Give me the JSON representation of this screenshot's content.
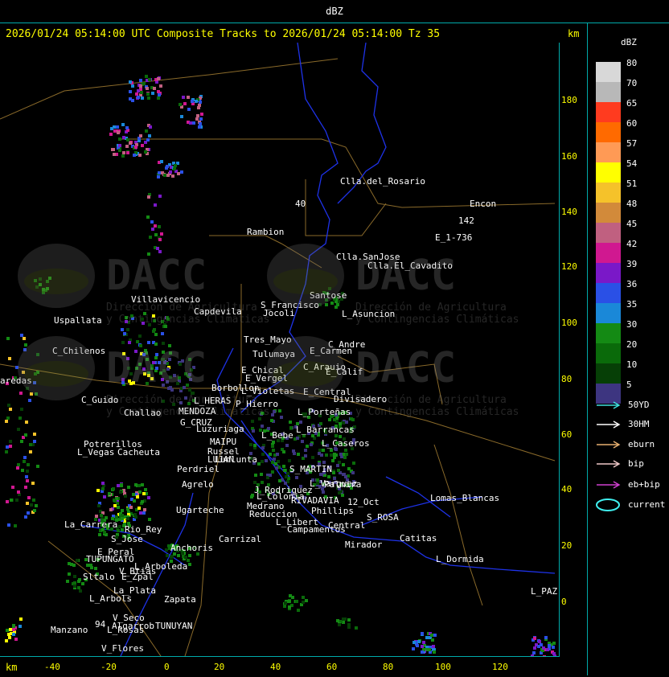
{
  "header": {
    "title": "dBZ"
  },
  "subtitle": "2026/01/24 05:14:00 UTC Composite Tracks to 2026/01/24 05:14:00 Tz 35",
  "axis": {
    "unit_top": "km",
    "unit_bottom": "km",
    "y_ticks": [
      "180",
      "160",
      "140",
      "120",
      "100",
      "80",
      "60",
      "40",
      "20",
      "0"
    ],
    "x_ticks": [
      "-40",
      "-20",
      "0",
      "20",
      "40",
      "60",
      "80",
      "100",
      "120"
    ]
  },
  "legend": {
    "title": "dBZ",
    "levels": [
      {
        "label": "80",
        "color": "#d8d8d8"
      },
      {
        "label": "70",
        "color": "#b8b8b8"
      },
      {
        "label": "65",
        "color": "#ff3b1f"
      },
      {
        "label": "60",
        "color": "#ff6a00"
      },
      {
        "label": "57",
        "color": "#ff9a55"
      },
      {
        "label": "54",
        "color": "#ffff00"
      },
      {
        "label": "51",
        "color": "#f5c22a"
      },
      {
        "label": "48",
        "color": "#d28a3a"
      },
      {
        "label": "45",
        "color": "#c06080"
      },
      {
        "label": "42",
        "color": "#d01890"
      },
      {
        "label": "39",
        "color": "#7a18c8"
      },
      {
        "label": "36",
        "color": "#2a50e6"
      },
      {
        "label": "35",
        "color": "#1a88d8"
      },
      {
        "label": "30",
        "color": "#148a14"
      },
      {
        "label": "20",
        "color": "#0a6a0a"
      },
      {
        "label": "10",
        "color": "#063f06"
      },
      {
        "label": "5",
        "color": "#3d3580"
      }
    ],
    "tracks": [
      {
        "label": "50YD",
        "color": "#40e0e0"
      },
      {
        "label": "30HM",
        "color": "#ffffff"
      },
      {
        "label": "eburn",
        "color": "#e8b070"
      },
      {
        "label": "bip",
        "color": "#f0c8c8"
      },
      {
        "label": "eb+bip",
        "color": "#d040d0"
      },
      {
        "label": "current",
        "color": "#40f0f0"
      }
    ]
  },
  "watermark": {
    "brand": "DACC",
    "line1": "Dirección de Agricultura",
    "line2": "y Contingencias Climáticas"
  },
  "places": [
    "Clla.del_Rosario",
    "Encon",
    "142",
    "E_1-736",
    "Rambion",
    "40",
    "Clla.SanJose",
    "Clla.El_Cavadito",
    "Villavicencio",
    "Capdevila",
    "S_Francisco",
    "Jocoli",
    "Santose",
    "L_Asuncion",
    "Uspallata",
    "Tres_Mayo",
    "Tulumaya",
    "E_Carmen",
    "C_Andre",
    "C_Chilenos",
    "E_Chical",
    "E_Vergel",
    "C_Arauio",
    "E_Calif",
    "aredas",
    "Borbollon",
    "L_Violetas",
    "E_Central",
    "Divisadero",
    "C_Guido",
    "L_HERAS",
    "P_Hierro",
    "Challao",
    "MENDOZA",
    "L_Porteñas",
    "G_CRUZ",
    "Luzuriaga",
    "L_Bebe",
    "L_Barrancas",
    "L_Caseros",
    "Potrerillos",
    "MAIPU",
    "Russel",
    "L_Vegas",
    "Cacheuta",
    "LUJAN",
    "Lunlunta",
    "S_MARTIN",
    "Perdriel",
    "Agrelo",
    "Medrano",
    "J_Rodriguez",
    "L_Varguez",
    "Palmira",
    "12_Oct",
    "Ugarteche",
    "L_Colonia",
    "RIVADAVIA",
    "Lomas_Blancas",
    "Reduccion",
    "S_ROSA",
    "La_Carrera",
    "Rio_Rey",
    "L_Libert",
    "Phillips",
    "S_Jose",
    "Carrizal",
    "Campamentos",
    "Central",
    "Catitas",
    "E_Peral",
    "Anchoris",
    "TUPUNGATO",
    "Mirador",
    "L_Dormida",
    "V_Btias",
    "L_Arboleda",
    "Sltalo",
    "E_Zpal",
    "L_Arbols",
    "La_Plata",
    "Zapata",
    "L_PAZ",
    "V_Seco",
    "Algarrob",
    "Manzano",
    "L_Rosas",
    "TUNUYAN",
    "V_Flores",
    "94"
  ]
}
